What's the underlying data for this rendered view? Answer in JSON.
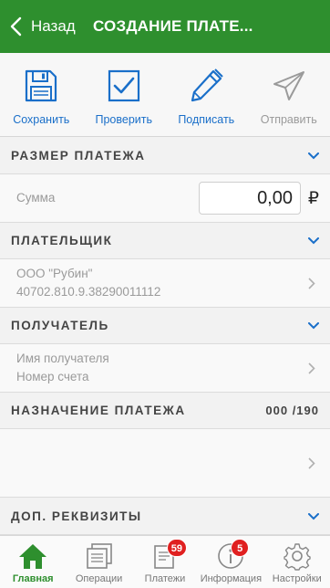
{
  "header": {
    "back_label": "Назад",
    "title": "СОЗДАНИЕ ПЛАТЕ..."
  },
  "toolbar": {
    "save": "Сохранить",
    "check": "Проверить",
    "sign": "Подписать",
    "send": "Отправить"
  },
  "sections": {
    "amount": {
      "title": "РАЗМЕР ПЛАТЕЖА",
      "label": "Сумма",
      "value": "0,00",
      "currency": "₽"
    },
    "payer": {
      "title": "ПЛАТЕЛЬЩИК",
      "name": "ООО \"Рубин\"",
      "account": "40702.810.9.38290011112"
    },
    "recipient": {
      "title": "ПОЛУЧАТЕЛЬ",
      "name_placeholder": "Имя получателя",
      "account_placeholder": "Номер счета"
    },
    "purpose": {
      "title": "НАЗНАЧЕНИЕ ПЛАТЕЖА",
      "counter": "000 /190"
    },
    "extra": {
      "title": "ДОП. РЕКВИЗИТЫ"
    }
  },
  "tabbar": {
    "home": "Главная",
    "operations": "Операции",
    "payments": "Платежи",
    "payments_badge": "59",
    "info": "Информация",
    "info_badge": "5",
    "settings": "Настройки"
  },
  "colors": {
    "brand_green": "#2e8f2e",
    "accent_blue": "#1a6fc9",
    "badge_red": "#e02020"
  }
}
